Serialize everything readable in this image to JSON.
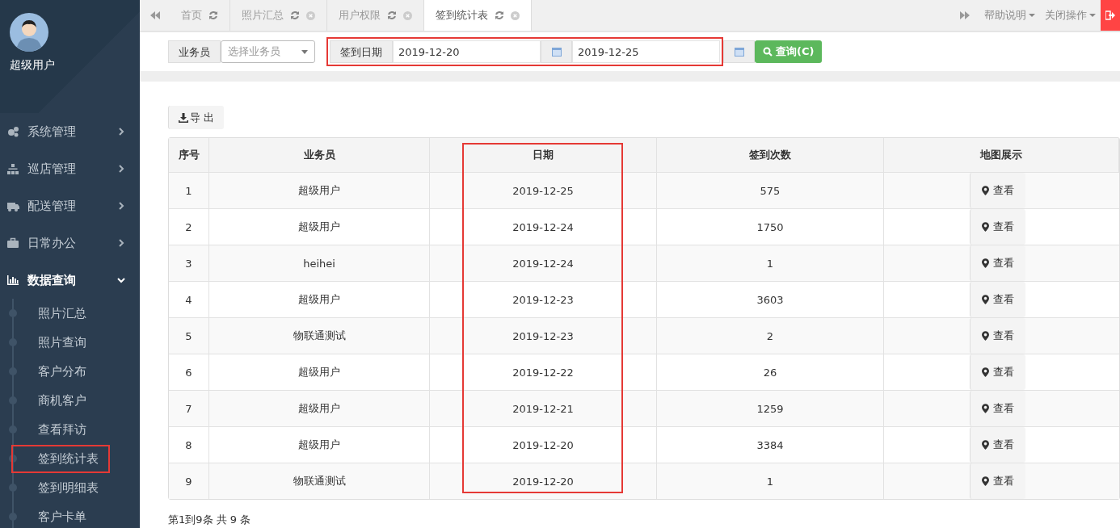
{
  "user": {
    "name": "超级用户"
  },
  "menu": [
    {
      "label": "系统管理",
      "expanded": false
    },
    {
      "label": "巡店管理",
      "expanded": false
    },
    {
      "label": "配送管理",
      "expanded": false
    },
    {
      "label": "日常办公",
      "expanded": false
    },
    {
      "label": "数据查询",
      "expanded": true,
      "children": [
        {
          "label": "照片汇总",
          "highlighted": false
        },
        {
          "label": "照片查询",
          "highlighted": false
        },
        {
          "label": "客户分布",
          "highlighted": false
        },
        {
          "label": "商机客户",
          "highlighted": false
        },
        {
          "label": "查看拜访",
          "highlighted": false
        },
        {
          "label": "签到统计表",
          "highlighted": true
        },
        {
          "label": "签到明细表",
          "highlighted": false
        },
        {
          "label": "客户卡单",
          "highlighted": false
        }
      ]
    }
  ],
  "tabs": [
    {
      "label": "首页",
      "selected": false,
      "closable": false
    },
    {
      "label": "照片汇总",
      "selected": false,
      "closable": true
    },
    {
      "label": "用户权限",
      "selected": false,
      "closable": true
    },
    {
      "label": "签到统计表",
      "selected": true,
      "closable": true
    }
  ],
  "top_actions": [
    "帮助说明",
    "关闭操作"
  ],
  "filter": {
    "salesman_label": "业务员",
    "salesman_placeholder": "选择业务员",
    "date_label": "签到日期",
    "date_from": "2019-12-20",
    "date_to": "2019-12-25",
    "date_highlighted": true,
    "query_button": "查询(C)"
  },
  "export_button": "导 出",
  "table": {
    "columns": [
      {
        "label": "序号",
        "highlighted": false
      },
      {
        "label": "业务员",
        "highlighted": false
      },
      {
        "label": "日期",
        "highlighted": true
      },
      {
        "label": "签到次数",
        "highlighted": false
      },
      {
        "label": "地图展示",
        "highlighted": false
      }
    ],
    "rows": [
      [
        "1",
        "超级用户",
        "2019-12-25",
        "575",
        "查看"
      ],
      [
        "2",
        "超级用户",
        "2019-12-24",
        "1750",
        "查看"
      ],
      [
        "3",
        "heihei",
        "2019-12-24",
        "1",
        "查看"
      ],
      [
        "4",
        "超级用户",
        "2019-12-23",
        "3603",
        "查看"
      ],
      [
        "5",
        "物联通测试",
        "2019-12-23",
        "2",
        "查看"
      ],
      [
        "6",
        "超级用户",
        "2019-12-22",
        "26",
        "查看"
      ],
      [
        "7",
        "超级用户",
        "2019-12-21",
        "1259",
        "查看"
      ],
      [
        "8",
        "超级用户",
        "2019-12-20",
        "3384",
        "查看"
      ],
      [
        "9",
        "物联通测试",
        "2019-12-20",
        "1",
        "查看"
      ]
    ]
  },
  "pagination": "第1到9条 共 9 条"
}
